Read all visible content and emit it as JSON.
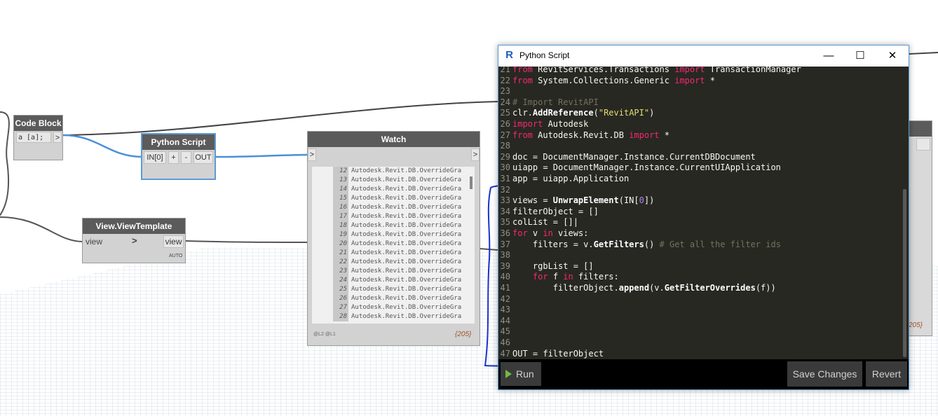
{
  "graph": {
    "code_block": {
      "title": "Code Block",
      "text": "a [a];",
      "out": ">"
    },
    "python_node": {
      "title": "Python Script",
      "in": "IN[0]",
      "plus": "+",
      "minus": "-",
      "out": "OUT"
    },
    "watch": {
      "title": "Watch",
      "in": ">",
      "out": ">",
      "items": [
        {
          "i": "12",
          "v": "Autodesk.Revit.DB.OverrideGra"
        },
        {
          "i": "13",
          "v": "Autodesk.Revit.DB.OverrideGra"
        },
        {
          "i": "14",
          "v": "Autodesk.Revit.DB.OverrideGra"
        },
        {
          "i": "15",
          "v": "Autodesk.Revit.DB.OverrideGra"
        },
        {
          "i": "16",
          "v": "Autodesk.Revit.DB.OverrideGra"
        },
        {
          "i": "17",
          "v": "Autodesk.Revit.DB.OverrideGra"
        },
        {
          "i": "18",
          "v": "Autodesk.Revit.DB.OverrideGra"
        },
        {
          "i": "19",
          "v": "Autodesk.Revit.DB.OverrideGra"
        },
        {
          "i": "20",
          "v": "Autodesk.Revit.DB.OverrideGra"
        },
        {
          "i": "21",
          "v": "Autodesk.Revit.DB.OverrideGra"
        },
        {
          "i": "22",
          "v": "Autodesk.Revit.DB.OverrideGra"
        },
        {
          "i": "23",
          "v": "Autodesk.Revit.DB.OverrideGra"
        },
        {
          "i": "24",
          "v": "Autodesk.Revit.DB.OverrideGra"
        },
        {
          "i": "25",
          "v": "Autodesk.Revit.DB.OverrideGra"
        },
        {
          "i": "26",
          "v": "Autodesk.Revit.DB.OverrideGra"
        },
        {
          "i": "27",
          "v": "Autodesk.Revit.DB.OverrideGra"
        },
        {
          "i": "28",
          "v": "Autodesk.Revit.DB.OverrideGra"
        }
      ],
      "levels": "@L2 @L1",
      "count": "{205}"
    },
    "view_template": {
      "title": "View.ViewTemplate",
      "in": "view",
      "in_arrow": ">",
      "out": "view",
      "lacing": "AUTO"
    },
    "partial_count": "205}"
  },
  "editor": {
    "title": "Python Script",
    "logo": "R",
    "minimize": "—",
    "maximize": "☐",
    "close": "✕",
    "run_label": "Run",
    "save_label": "Save Changes",
    "revert_label": "Revert",
    "lines": [
      {
        "n": "21",
        "html": "<span class=\"kw\">from</span> RevitServices.Transactions <span class=\"kw\">import</span> TransactionManager"
      },
      {
        "n": "22",
        "html": "<span class=\"kw\">from</span> System.Collections.Generic <span class=\"kw\">import</span> *"
      },
      {
        "n": "23",
        "html": ""
      },
      {
        "n": "24",
        "html": "<span class=\"cm\"># Import RevitAPI</span>"
      },
      {
        "n": "25",
        "html": "clr.<span class=\"fn\">AddReference</span>(<span class=\"st\">\"RevitAPI\"</span>)"
      },
      {
        "n": "26",
        "html": "<span class=\"kw\">import</span> Autodesk"
      },
      {
        "n": "27",
        "html": "<span class=\"kw\">from</span> Autodesk.Revit.DB <span class=\"kw\">import</span> *"
      },
      {
        "n": "28",
        "html": ""
      },
      {
        "n": "29",
        "html": "doc = DocumentManager.Instance.CurrentDBDocument"
      },
      {
        "n": "30",
        "html": "uiapp = DocumentManager.Instance.CurrentUIApplication"
      },
      {
        "n": "31",
        "html": "app = uiapp.Application"
      },
      {
        "n": "32",
        "html": ""
      },
      {
        "n": "33",
        "html": "views = <span class=\"fn\">UnwrapElement</span>(IN[<span class=\"nm\">0</span>])"
      },
      {
        "n": "34",
        "html": "filterObject = []"
      },
      {
        "n": "35",
        "html": "colList = []|"
      },
      {
        "n": "36",
        "html": "<span class=\"kw\">for</span> v <span class=\"kw\">in</span> views:"
      },
      {
        "n": "37",
        "html": "    filters = v.<span class=\"fn\">GetFilters</span>() <span class=\"cm\"># Get all the filter ids</span>"
      },
      {
        "n": "38",
        "html": ""
      },
      {
        "n": "39",
        "html": "    rgbList = []"
      },
      {
        "n": "40",
        "html": "    <span class=\"kw\">for</span> f <span class=\"kw\">in</span> filters:"
      },
      {
        "n": "41",
        "html": "        filterObject.<span class=\"fn\">append</span>(v.<span class=\"fn\">GetFilterOverrides</span>(f))"
      },
      {
        "n": "42",
        "html": ""
      },
      {
        "n": "43",
        "html": ""
      },
      {
        "n": "44",
        "html": ""
      },
      {
        "n": "45",
        "html": ""
      },
      {
        "n": "46",
        "html": ""
      },
      {
        "n": "47",
        "html": "OUT = filterObject"
      }
    ]
  }
}
